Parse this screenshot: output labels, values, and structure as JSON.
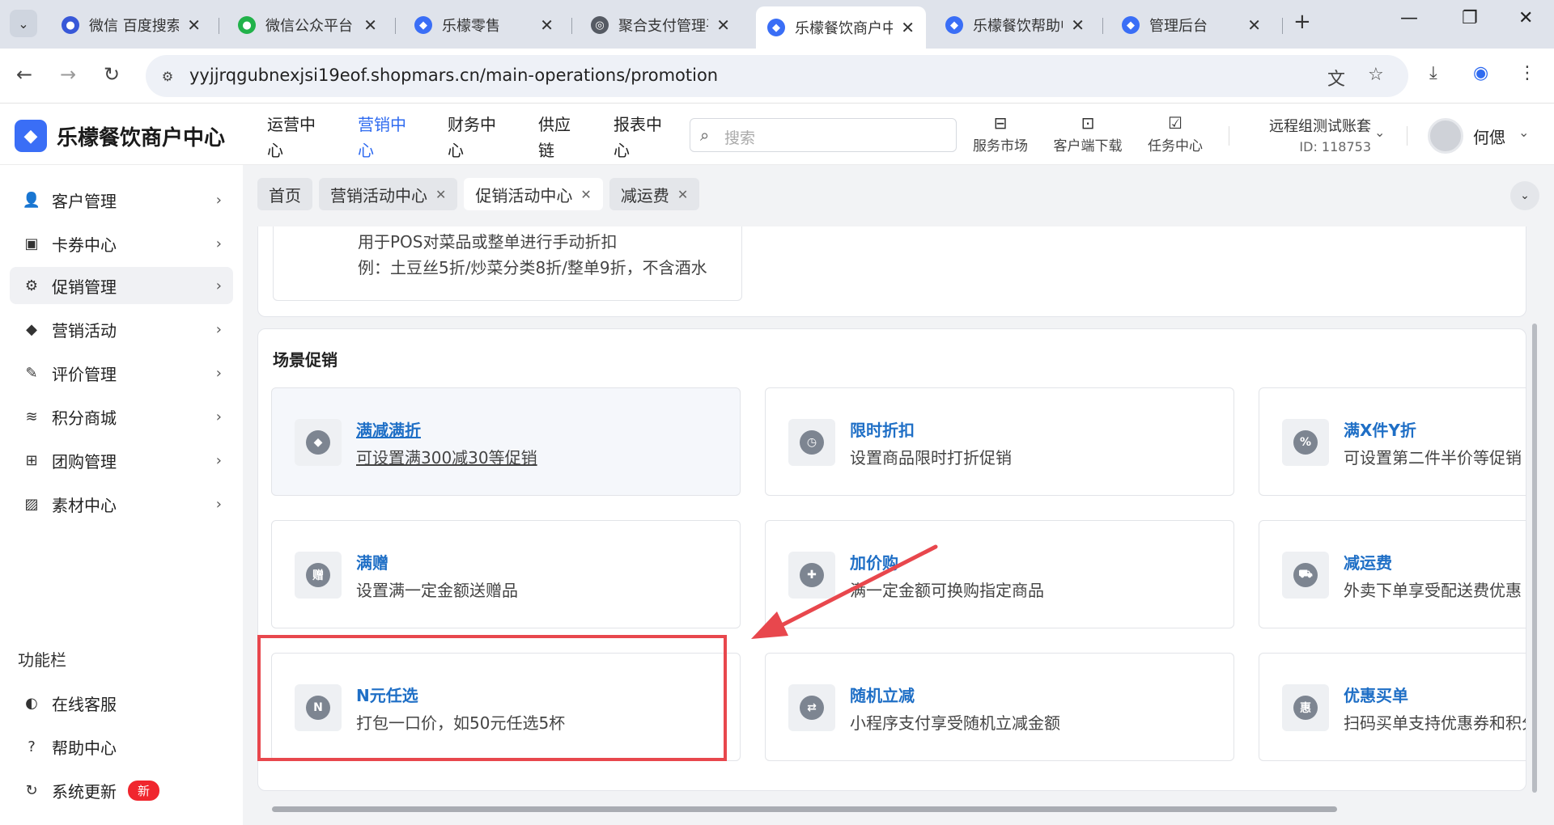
{
  "browser": {
    "tabs": [
      {
        "title": "微信 百度搜索",
        "fav_color": "#3858d8",
        "fav_glyph": "🐾",
        "active": false
      },
      {
        "title": "微信公众平台",
        "fav_color": "#21b24a",
        "fav_glyph": "●",
        "active": false
      },
      {
        "title": "乐檬零售",
        "fav_color": "#3a6ef6",
        "fav_glyph": "◆",
        "active": false
      },
      {
        "title": "聚合支付管理平台",
        "fav_color": "#555a63",
        "fav_glyph": "◎",
        "active": false
      },
      {
        "title": "乐檬餐饮商户中心",
        "fav_color": "#3a6ef6",
        "fav_glyph": "◆",
        "active": true
      },
      {
        "title": "乐檬餐饮帮助中心",
        "fav_color": "#3a6ef6",
        "fav_glyph": "◆",
        "active": false
      },
      {
        "title": "管理后台",
        "fav_color": "#3a6ef6",
        "fav_glyph": "◆",
        "active": false
      }
    ],
    "new_tab": "+",
    "url": "yyjjrqgubnexjsi19eof.shopmars.cn/main-operations/promotion"
  },
  "header": {
    "logo_text": "乐檬餐饮商户中心",
    "nav": [
      {
        "line1": "运营中",
        "line2": "心",
        "active": false
      },
      {
        "line1": "营销中",
        "line2": "心",
        "active": true
      },
      {
        "line1": "财务中",
        "line2": "心",
        "active": false
      },
      {
        "line1": "供应",
        "line2": "链",
        "active": false
      },
      {
        "line1": "报表中",
        "line2": "心",
        "active": false
      }
    ],
    "search_placeholder": "搜索",
    "tools": {
      "service_market": "服务市场",
      "client_download": "客户端下载",
      "task_center": "任务中心"
    },
    "account_name": "远程组测试账套",
    "account_id": "ID: 118753",
    "user_name": "何偲"
  },
  "sidebar": {
    "items": [
      {
        "label": "客户管理",
        "icon": "user-icon"
      },
      {
        "label": "卡券中心",
        "icon": "card-icon"
      },
      {
        "label": "促销管理",
        "icon": "gear-icon"
      },
      {
        "label": "营销活动",
        "icon": "tag-icon"
      },
      {
        "label": "评价管理",
        "icon": "edit-icon"
      },
      {
        "label": "积分商城",
        "icon": "coins-icon"
      },
      {
        "label": "团购管理",
        "icon": "gift-icon"
      },
      {
        "label": "素材中心",
        "icon": "image-icon"
      }
    ],
    "active_index": 2,
    "function_heading": "功能栏",
    "functions": [
      {
        "label": "在线客服",
        "icon": "headset-icon"
      },
      {
        "label": "帮助中心",
        "icon": "help-icon"
      },
      {
        "label": "系统更新",
        "icon": "refresh-icon",
        "badge": "新"
      }
    ]
  },
  "content_tabs": [
    {
      "label": "首页",
      "closable": false,
      "active": false
    },
    {
      "label": "营销活动中心",
      "closable": true,
      "active": false
    },
    {
      "label": "促销活动中心",
      "closable": true,
      "active": true
    },
    {
      "label": "减运费",
      "closable": true,
      "active": false
    }
  ],
  "previous_card": {
    "line1": "用于POS对菜品或整单进行手动折扣",
    "line2": "例：土豆丝5折/炒菜分类8折/整单9折，不含酒水"
  },
  "scene_section": {
    "title": "场景促销",
    "cards": [
      {
        "title": "满减满折",
        "desc": "可设置满300减30等促销",
        "icon": "tag-icon",
        "glyph": "◆"
      },
      {
        "title": "限时折扣",
        "desc": "设置商品限时打折促销",
        "icon": "clock-tag-icon",
        "glyph": "◷"
      },
      {
        "title": "满X件Y折",
        "desc": "可设置第二件半价等促销",
        "icon": "percent-icon",
        "glyph": "%"
      },
      {
        "title": "满赠",
        "desc": "设置满一定金额送赠品",
        "icon": "gift-badge-icon",
        "glyph": "赠"
      },
      {
        "title": "加价购",
        "desc": "满一定金额可换购指定商品",
        "icon": "cart-icon",
        "glyph": "✚"
      },
      {
        "title": "减运费",
        "desc": "外卖下单享受配送费优惠",
        "icon": "truck-icon",
        "glyph": "⛟"
      },
      {
        "title": "N元任选",
        "desc": "打包一口价，如50元任选5杯",
        "icon": "n-choice-icon",
        "glyph": "N"
      },
      {
        "title": "随机立减",
        "desc": "小程序支付享受随机立减金额",
        "icon": "shuffle-icon",
        "glyph": "⇄"
      },
      {
        "title": "优惠买单",
        "desc": "扫码买单支持优惠券和积分",
        "icon": "receipt-icon",
        "glyph": "惠"
      }
    ]
  },
  "colors": {
    "accent": "#2f6bf0",
    "link": "#1f6fc6",
    "highlight": "#e8474d"
  }
}
